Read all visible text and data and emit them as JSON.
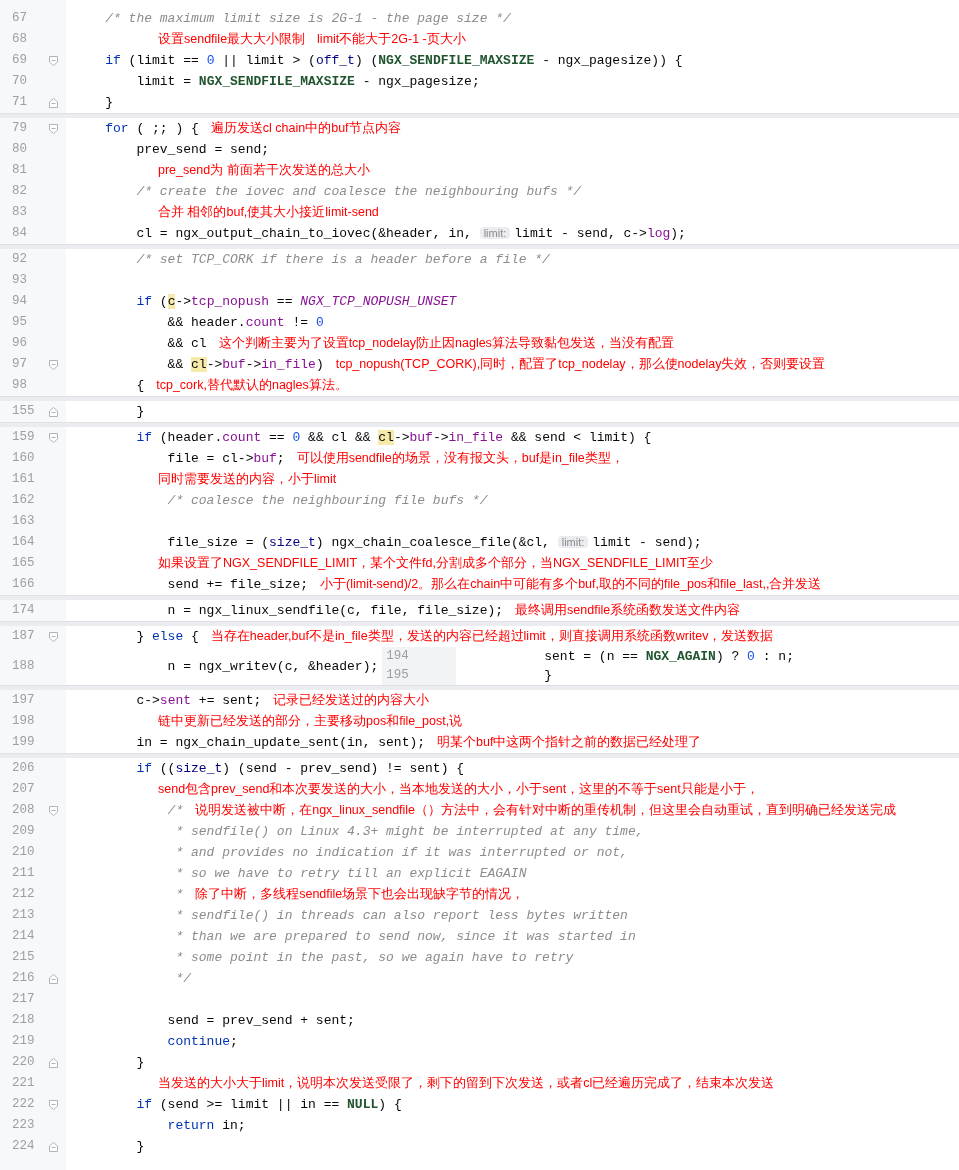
{
  "lines": [
    {
      "number": "67",
      "code": [
        {
          "kind": "cm",
          "text": "    /* the maximum limit size is 2G-1 - the page size */"
        }
      ]
    },
    {
      "number": "68",
      "notes": [
        "设置sendfile最大大小限制",
        "limit不能大于2G-1 -页大小"
      ]
    },
    {
      "number": "69",
      "fold_start": true,
      "code": [
        {
          "kind": "kw",
          "text": "    if"
        },
        {
          "kind": "p",
          "text": " (limit == "
        },
        {
          "kind": "num",
          "text": "0"
        },
        {
          "kind": "p",
          "text": " || limit > ("
        },
        {
          "kind": "ty",
          "text": "off_t"
        },
        {
          "kind": "p",
          "text": ") ("
        },
        {
          "kind": "mac",
          "text": "NGX_SENDFILE_MAXSIZE"
        },
        {
          "kind": "p",
          "text": " - ngx_pagesize)) {"
        }
      ]
    },
    {
      "number": "70",
      "code": [
        {
          "kind": "p",
          "text": "        limit = "
        },
        {
          "kind": "mac",
          "text": "NGX_SENDFILE_MAXSIZE"
        },
        {
          "kind": "p",
          "text": " - ngx_pagesize;"
        }
      ]
    },
    {
      "number": "71",
      "fold_end": true,
      "code": [
        {
          "kind": "p",
          "text": "    }"
        }
      ]
    },
    {
      "number": "79",
      "separator": true,
      "fold_start": true,
      "code": [
        {
          "kind": "kw",
          "text": "    for"
        },
        {
          "kind": "p",
          "text": " ( ;; ) {"
        }
      ],
      "notes": [
        "遍历发送cl chain中的buf节点内容"
      ]
    },
    {
      "number": "80",
      "code": [
        {
          "kind": "p",
          "text": "        prev_send = send;"
        }
      ]
    },
    {
      "number": "81",
      "notes": [
        "pre_send为 前面若干次发送的总大小"
      ]
    },
    {
      "number": "82",
      "code": [
        {
          "kind": "cm",
          "text": "        /* create the iovec and coalesce the neighbouring bufs */"
        }
      ]
    },
    {
      "number": "83",
      "notes": [
        "合并 相邻的buf,使其大小接近limit-send"
      ]
    },
    {
      "number": "84",
      "code": [
        {
          "kind": "p",
          "text": "        cl = ngx_output_chain_to_iovec(&header, in, "
        },
        {
          "kind": "hint",
          "text": "limit:"
        },
        {
          "kind": "p",
          "text": "limit - send, c->"
        },
        {
          "kind": "fld",
          "text": "log"
        },
        {
          "kind": "p",
          "text": ");"
        }
      ]
    },
    {
      "number": "92",
      "separator": true,
      "code": [
        {
          "kind": "cm",
          "text": "        /* set TCP_CORK if there is a header before a file */"
        }
      ]
    },
    {
      "number": "93"
    },
    {
      "number": "94",
      "code": [
        {
          "kind": "kw",
          "text": "        if"
        },
        {
          "kind": "p",
          "text": " ("
        },
        {
          "kind": "hl",
          "text": "c"
        },
        {
          "kind": "p",
          "text": "->"
        },
        {
          "kind": "fld",
          "text": "tcp_nopush"
        },
        {
          "kind": "p",
          "text": " == "
        },
        {
          "kind": "imac",
          "text": "NGX_TCP_NOPUSH_UNSET"
        }
      ]
    },
    {
      "number": "95",
      "code": [
        {
          "kind": "p",
          "text": "            && header."
        },
        {
          "kind": "fld",
          "text": "count"
        },
        {
          "kind": "p",
          "text": " != "
        },
        {
          "kind": "num",
          "text": "0"
        }
      ]
    },
    {
      "number": "96",
      "code": [
        {
          "kind": "p",
          "text": "            && cl"
        }
      ],
      "notes": [
        "这个判断主要为了设置tcp_nodelay防止因nagles算法导致黏包发送，当没有配置"
      ]
    },
    {
      "number": "97",
      "fold_start": true,
      "code": [
        {
          "kind": "p",
          "text": "            && "
        },
        {
          "kind": "hl",
          "text": "cl"
        },
        {
          "kind": "p",
          "text": "->"
        },
        {
          "kind": "fld",
          "text": "buf"
        },
        {
          "kind": "p",
          "text": "->"
        },
        {
          "kind": "fld",
          "text": "in_file"
        },
        {
          "kind": "p",
          "text": ")"
        }
      ],
      "notes": [
        "tcp_nopush(TCP_CORK),同时，配置了tcp_nodelay，那么使nodelay失效，否则要设置"
      ]
    },
    {
      "number": "98",
      "code": [
        {
          "kind": "p",
          "text": "        {"
        }
      ],
      "notes": [
        "tcp_cork,替代默认的nagles算法。"
      ]
    },
    {
      "number": "155",
      "separator": true,
      "fold_end": true,
      "code": [
        {
          "kind": "p",
          "text": "        }"
        }
      ]
    },
    {
      "number": "159",
      "separator": true,
      "fold_start": true,
      "code": [
        {
          "kind": "kw",
          "text": "        if"
        },
        {
          "kind": "p",
          "text": " (header."
        },
        {
          "kind": "fld",
          "text": "count"
        },
        {
          "kind": "p",
          "text": " == "
        },
        {
          "kind": "num",
          "text": "0"
        },
        {
          "kind": "p",
          "text": " && cl && "
        },
        {
          "kind": "hl",
          "text": "cl"
        },
        {
          "kind": "p",
          "text": "->"
        },
        {
          "kind": "fld",
          "text": "buf"
        },
        {
          "kind": "p",
          "text": "->"
        },
        {
          "kind": "fld",
          "text": "in_file"
        },
        {
          "kind": "p",
          "text": " && send < limit) {"
        }
      ]
    },
    {
      "number": "160",
      "code": [
        {
          "kind": "p",
          "text": "            file = cl->"
        },
        {
          "kind": "fld",
          "text": "buf"
        },
        {
          "kind": "p",
          "text": ";"
        }
      ],
      "notes": [
        "可以使用sendfile的场景，没有报文头，buf是in_file类型，"
      ]
    },
    {
      "number": "161",
      "notes": [
        "同时需要发送的内容，小于limit"
      ]
    },
    {
      "number": "162",
      "code": [
        {
          "kind": "cm",
          "text": "            /* coalesce the neighbouring file bufs */"
        }
      ]
    },
    {
      "number": "163"
    },
    {
      "number": "164",
      "code": [
        {
          "kind": "p",
          "text": "            file_size = ("
        },
        {
          "kind": "ty",
          "text": "size_t"
        },
        {
          "kind": "p",
          "text": ") ngx_chain_coalesce_file(&cl, "
        },
        {
          "kind": "hint",
          "text": "limit:"
        },
        {
          "kind": "p",
          "text": "limit - send);"
        }
      ]
    },
    {
      "number": "165",
      "notes": [
        "如果设置了NGX_SENDFILE_LIMIT，某个文件fd,分割成多个部分，当NGX_SENDFILE_LIMIT至少"
      ]
    },
    {
      "number": "166",
      "code": [
        {
          "kind": "p",
          "text": "            send += file_size;"
        }
      ],
      "notes": [
        "小于(limit-send)/2。那么在chain中可能有多个buf,取的不同的file_pos和file_last,,合并发送"
      ]
    },
    {
      "number": "174",
      "separator": true,
      "code": [
        {
          "kind": "p",
          "text": "            n = ngx_linux_sendfile(c, file, file_size);"
        }
      ],
      "notes": [
        "最终调用sendfile系统函数发送文件内容"
      ]
    },
    {
      "number": "187",
      "separator": true,
      "fold_start": true,
      "code": [
        {
          "kind": "p",
          "text": "        } "
        },
        {
          "kind": "kw",
          "text": "else"
        },
        {
          "kind": "p",
          "text": " {"
        }
      ],
      "notes": [
        "当存在header,buf不是in_file类型，发送的内容已经超过limit，则直接调用系统函数writev，发送数据"
      ]
    },
    {
      "number": "188",
      "code": [
        {
          "kind": "p",
          "text": "            n = ngx_writev(c, &header);"
        }
      ],
      "inset": {
        "numbers": [
          "194",
          "195"
        ],
        "code": [
          [
            {
              "kind": "p",
              "text": "sent = (n == "
            },
            {
              "kind": "mac",
              "text": "NGX_AGAIN"
            },
            {
              "kind": "p",
              "text": ") ? "
            },
            {
              "kind": "num",
              "text": "0"
            },
            {
              "kind": "p",
              "text": " : n;"
            }
          ],
          [
            {
              "kind": "p",
              "text": "}"
            }
          ]
        ]
      }
    },
    {
      "number": "197",
      "separator": true,
      "code": [
        {
          "kind": "p",
          "text": "        c->"
        },
        {
          "kind": "fld",
          "text": "sent"
        },
        {
          "kind": "p",
          "text": " += sent;"
        }
      ],
      "notes": [
        "记录已经发送过的内容大小"
      ]
    },
    {
      "number": "198",
      "notes": [
        "链中更新已经发送的部分，主要移动pos和file_post,说"
      ]
    },
    {
      "number": "199",
      "code": [
        {
          "kind": "p",
          "text": "        in = ngx_chain_update_sent(in, sent);"
        }
      ],
      "notes": [
        "明某个buf中这两个指针之前的数据已经处理了"
      ]
    },
    {
      "number": "206",
      "separator": true,
      "code": [
        {
          "kind": "kw",
          "text": "        if"
        },
        {
          "kind": "p",
          "text": " (("
        },
        {
          "kind": "ty",
          "text": "size_t"
        },
        {
          "kind": "p",
          "text": ") (send - prev_send) != sent) {"
        }
      ]
    },
    {
      "number": "207",
      "notes": [
        "send包含prev_send和本次要发送的大小，当本地发送的大小，小于sent，这里的不等于sent只能是小于，"
      ]
    },
    {
      "number": "208",
      "fold_start": true,
      "code": [
        {
          "kind": "cm",
          "text": "            /*"
        }
      ],
      "notes": [
        "说明发送被中断，在ngx_linux_sendfile（）方法中，会有针对中断的重传机制，但这里会自动重试，直到明确已经发送完成"
      ]
    },
    {
      "number": "209",
      "code": [
        {
          "kind": "cm",
          "text": "             * sendfile() on Linux 4.3+ might be interrupted at any time,"
        }
      ]
    },
    {
      "number": "210",
      "code": [
        {
          "kind": "cm",
          "text": "             * and provides no indication if it was interrupted or not,"
        }
      ]
    },
    {
      "number": "211",
      "code": [
        {
          "kind": "cm",
          "text": "             * so we have to retry till an explicit EAGAIN"
        }
      ]
    },
    {
      "number": "212",
      "code": [
        {
          "kind": "cm",
          "text": "             *"
        }
      ],
      "notes": [
        "除了中断，多线程sendfile场景下也会出现缺字节的情况，"
      ]
    },
    {
      "number": "213",
      "code": [
        {
          "kind": "cm",
          "text": "             * sendfile() in threads can also report less bytes written"
        }
      ]
    },
    {
      "number": "214",
      "code": [
        {
          "kind": "cm",
          "text": "             * than we are prepared to send now, since it was started in"
        }
      ]
    },
    {
      "number": "215",
      "code": [
        {
          "kind": "cm",
          "text": "             * some point in the past, so we again have to retry"
        }
      ]
    },
    {
      "number": "216",
      "fold_end": true,
      "code": [
        {
          "kind": "cm",
          "text": "             */"
        }
      ]
    },
    {
      "number": "217"
    },
    {
      "number": "218",
      "code": [
        {
          "kind": "p",
          "text": "            send = prev_send + sent;"
        }
      ]
    },
    {
      "number": "219",
      "code": [
        {
          "kind": "kw",
          "text": "            continue"
        },
        {
          "kind": "p",
          "text": ";"
        }
      ]
    },
    {
      "number": "220",
      "fold_end": true,
      "code": [
        {
          "kind": "p",
          "text": "        }"
        }
      ]
    },
    {
      "number": "221",
      "notes": [
        "当发送的大小大于limit，说明本次发送受限了，剩下的留到下次发送，或者cl已经遍历完成了，结束本次发送"
      ]
    },
    {
      "number": "222",
      "fold_start": true,
      "code": [
        {
          "kind": "kw",
          "text": "        if"
        },
        {
          "kind": "p",
          "text": " (send >= limit || in == "
        },
        {
          "kind": "mac",
          "text": "NULL"
        },
        {
          "kind": "p",
          "text": ") {"
        }
      ]
    },
    {
      "number": "223",
      "code": [
        {
          "kind": "kw",
          "text": "            return"
        },
        {
          "kind": "p",
          "text": " in;"
        }
      ]
    },
    {
      "number": "224",
      "fold_end": true,
      "code": [
        {
          "kind": "p",
          "text": "        }"
        }
      ]
    }
  ]
}
